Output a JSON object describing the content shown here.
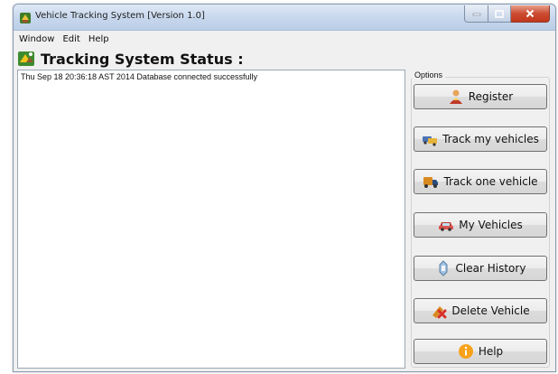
{
  "window": {
    "title": "Vehicle Tracking System [Version 1.0]"
  },
  "menu": [
    {
      "label": "Window"
    },
    {
      "label": "Edit"
    },
    {
      "label": "Help"
    }
  ],
  "header": {
    "title": "Tracking System Status :"
  },
  "log": {
    "lines": [
      "Thu Sep 18 20:36:18 AST 2014  Database connected successfully"
    ]
  },
  "options": {
    "legend": "Options",
    "buttons": [
      {
        "label": "Register",
        "icon": "person-icon"
      },
      {
        "label": "Track my vehicles",
        "icon": "vehicles-icon"
      },
      {
        "label": "Track one vehicle",
        "icon": "truck-icon"
      },
      {
        "label": "My Vehicles",
        "icon": "car-icon"
      },
      {
        "label": "Clear History",
        "icon": "eraser-icon"
      },
      {
        "label": "Delete Vehicle",
        "icon": "delete-icon"
      },
      {
        "label": "Help",
        "icon": "info-icon"
      }
    ]
  },
  "colors": {
    "close_button": "#c2371c",
    "info_icon": "#f7a21b"
  }
}
